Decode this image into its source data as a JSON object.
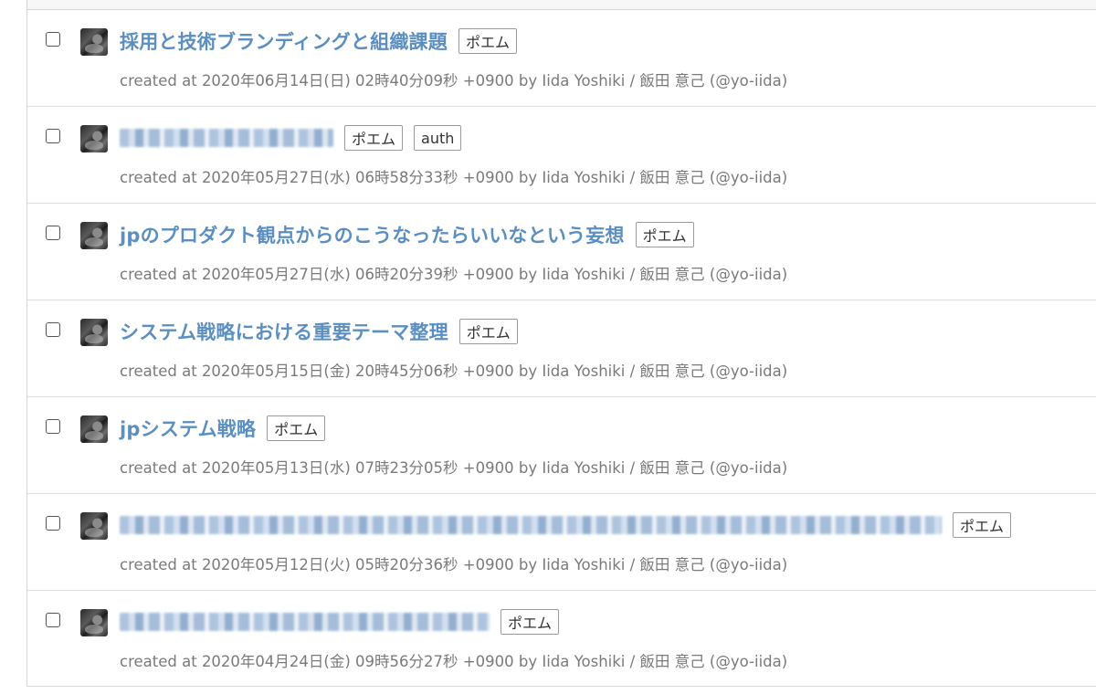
{
  "posts": [
    {
      "title": "採用と技術ブランディングと組織課題",
      "blurred": false,
      "tags": [
        "ポエム"
      ],
      "created_prefix": "created at",
      "date": "2020年06月14日(日) 02時40分09秒 +0900",
      "by": "by",
      "author": "Iida Yoshiki / 飯田 意己 (@yo-iida)"
    },
    {
      "title": "",
      "blurred": true,
      "blur_len": 0.26,
      "tags": [
        "ポエム",
        "auth"
      ],
      "created_prefix": "created at",
      "date": "2020年05月27日(水) 06時58分33秒 +0900",
      "by": "by",
      "author": "Iida Yoshiki / 飯田 意己 (@yo-iida)"
    },
    {
      "title": "jpのプロダクト観点からのこうなったらいいなという妄想",
      "blurred": false,
      "tags": [
        "ポエム"
      ],
      "created_prefix": "created at",
      "date": "2020年05月27日(水) 06時20分39秒 +0900",
      "by": "by",
      "author": "Iida Yoshiki / 飯田 意己 (@yo-iida)"
    },
    {
      "title": "システム戦略における重要テーマ整理",
      "blurred": false,
      "tags": [
        "ポエム"
      ],
      "created_prefix": "created at",
      "date": "2020年05月15日(金) 20時45分06秒 +0900",
      "by": "by",
      "author": "Iida Yoshiki / 飯田 意己 (@yo-iida)"
    },
    {
      "title": "jpシステム戦略",
      "blurred": false,
      "tags": [
        "ポエム"
      ],
      "created_prefix": "created at",
      "date": "2020年05月13日(水) 07時23分05秒 +0900",
      "by": "by",
      "author": "Iida Yoshiki / 飯田 意己 (@yo-iida)"
    },
    {
      "title": "",
      "blurred": true,
      "blur_len": 1.0,
      "tags": [
        "ポエム"
      ],
      "created_prefix": "created at",
      "date": "2020年05月12日(火) 05時20分36秒 +0900",
      "by": "by",
      "author": "Iida Yoshiki / 飯田 意己 (@yo-iida)"
    },
    {
      "title": "",
      "blurred": true,
      "blur_len": 0.45,
      "tags": [
        "ポエム"
      ],
      "created_prefix": "created at",
      "date": "2020年04月24日(金) 09時56分27秒 +0900",
      "by": "by",
      "author": "Iida Yoshiki / 飯田 意己 (@yo-iida)"
    }
  ],
  "colors": {
    "title_link": "#5b8fc2",
    "meta_text": "#7a7a7a",
    "border": "#dedede"
  }
}
